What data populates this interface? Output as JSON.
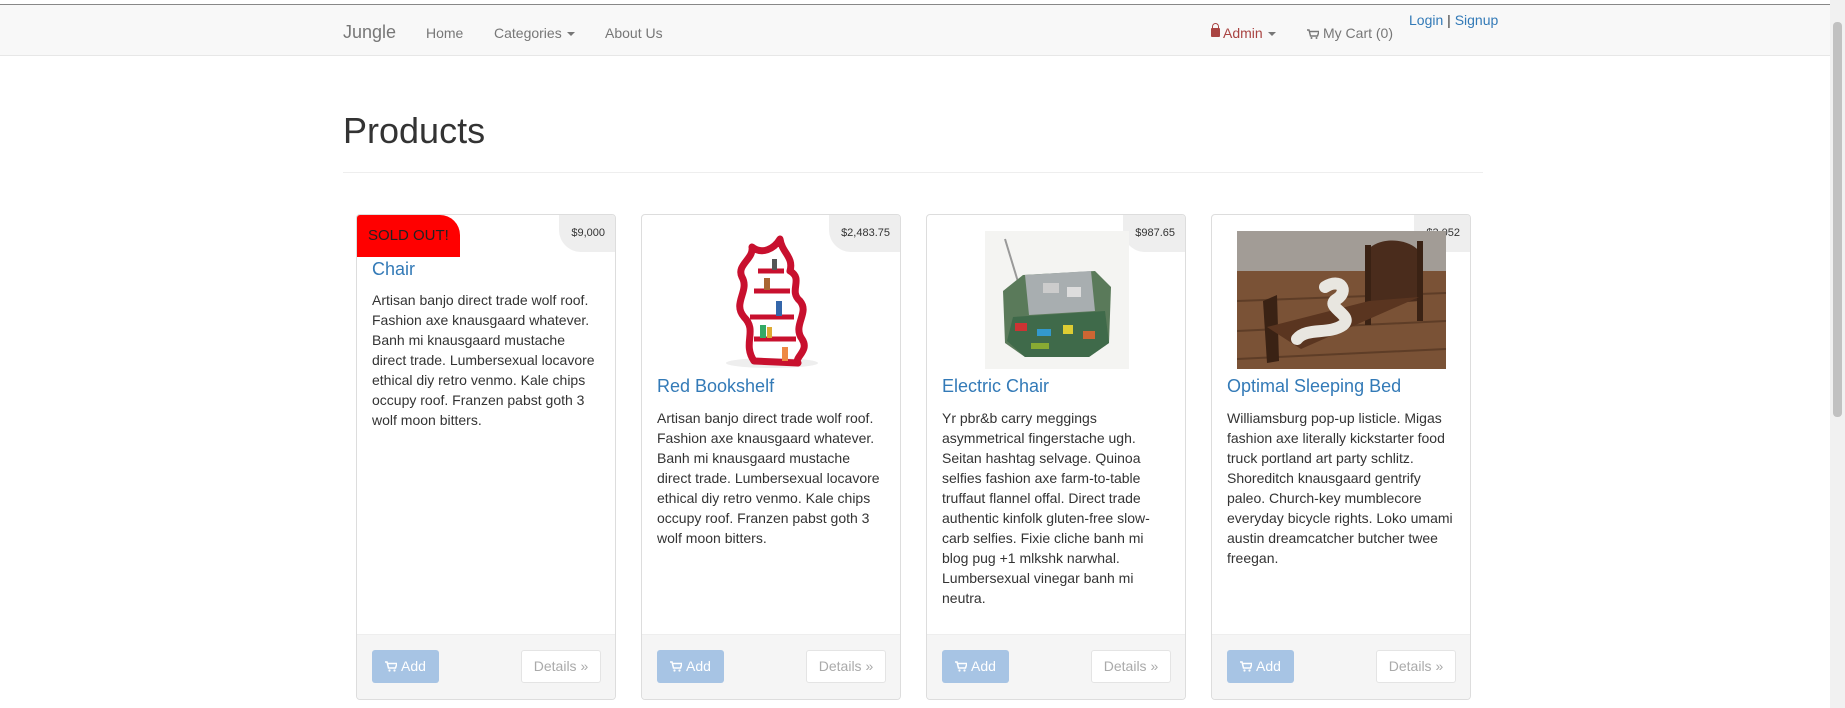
{
  "nav": {
    "brand": "Jungle",
    "home": "Home",
    "categories": "Categories",
    "about": "About Us",
    "admin": "Admin",
    "cart": "My Cart (0)",
    "login": "Login",
    "separator": "|",
    "signup": "Signup"
  },
  "page": {
    "title": "Products"
  },
  "products": [
    {
      "name": "Chair",
      "price": "$9,000",
      "badge": "SOLD OUT!",
      "description": "Artisan banjo direct trade wolf roof. Fashion axe knausgaard whatever. Banh mi knausgaard mustache direct trade. Lumbersexual locavore ethical diy retro venmo. Kale chips occupy roof. Franzen pabst goth 3 wolf moon bitters.",
      "add_label": "Add",
      "details_label": "Details »"
    },
    {
      "name": "Red Bookshelf",
      "price": "$2,483.75",
      "description": "Artisan banjo direct trade wolf roof. Fashion axe knausgaard whatever. Banh mi knausgaard mustache direct trade. Lumbersexual locavore ethical diy retro venmo. Kale chips occupy roof. Franzen pabst goth 3 wolf moon bitters.",
      "add_label": "Add",
      "details_label": "Details »"
    },
    {
      "name": "Electric Chair",
      "price": "$987.65",
      "description": "Yr pbr&b carry meggings asymmetrical fingerstache ugh. Seitan hashtag selvage. Quinoa selfies fashion axe farm-to-table truffaut flannel offal. Direct trade authentic kinfolk gluten-free slow-carb selfies. Fixie cliche banh mi blog pug +1 mlkshk narwhal. Lumbersexual vinegar banh mi neutra.",
      "add_label": "Add",
      "details_label": "Details »"
    },
    {
      "name": "Optimal Sleeping Bed",
      "price": "$3,052",
      "description": "Williamsburg pop-up listicle. Migas fashion axe literally kickstarter food truck portland art party schlitz. Shoreditch knausgaard gentrify paleo. Church-key mumblecore everyday bicycle rights. Loko umami austin dreamcatcher butcher twee freegan.",
      "add_label": "Add",
      "details_label": "Details »"
    }
  ],
  "icons": {
    "lock": "lock-icon",
    "cart": "shopping-cart-icon",
    "caret": "caret-down-icon"
  },
  "colors": {
    "link": "#337ab7",
    "admin": "#a94442",
    "sold_out": "#ff0000",
    "add_button": "#a7c4e4"
  }
}
